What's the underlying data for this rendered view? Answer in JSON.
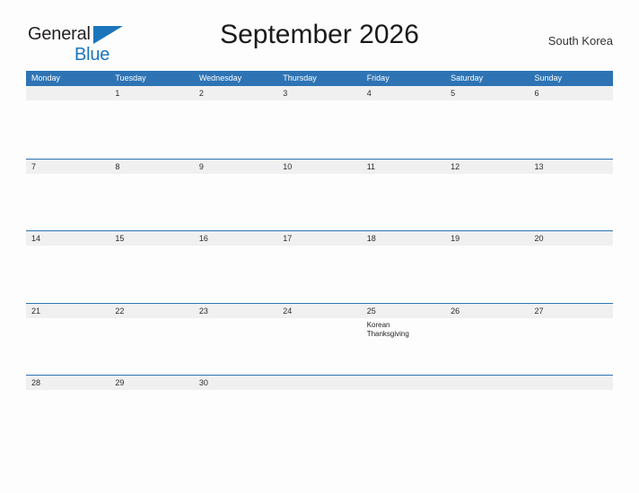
{
  "brand": {
    "name_part1": "General",
    "name_part2": "Blue",
    "flag_icon": "blue-triangle-flag",
    "color_dark": "#231f20",
    "color_blue": "#1b75bb"
  },
  "header": {
    "title": "September 2026",
    "region": "South Korea"
  },
  "theme": {
    "header_blue": "#2e74b5",
    "band_gray": "#f0f0f0",
    "page_background": "#fdfdfd",
    "text_color": "#222222"
  },
  "calendar": {
    "weekdays": [
      "Monday",
      "Tuesday",
      "Wednesday",
      "Thursday",
      "Friday",
      "Saturday",
      "Sunday"
    ],
    "weeks": [
      {
        "days": [
          {
            "number": "",
            "event": ""
          },
          {
            "number": "1",
            "event": ""
          },
          {
            "number": "2",
            "event": ""
          },
          {
            "number": "3",
            "event": ""
          },
          {
            "number": "4",
            "event": ""
          },
          {
            "number": "5",
            "event": ""
          },
          {
            "number": "6",
            "event": ""
          }
        ]
      },
      {
        "days": [
          {
            "number": "7",
            "event": ""
          },
          {
            "number": "8",
            "event": ""
          },
          {
            "number": "9",
            "event": ""
          },
          {
            "number": "10",
            "event": ""
          },
          {
            "number": "11",
            "event": ""
          },
          {
            "number": "12",
            "event": ""
          },
          {
            "number": "13",
            "event": ""
          }
        ]
      },
      {
        "days": [
          {
            "number": "14",
            "event": ""
          },
          {
            "number": "15",
            "event": ""
          },
          {
            "number": "16",
            "event": ""
          },
          {
            "number": "17",
            "event": ""
          },
          {
            "number": "18",
            "event": ""
          },
          {
            "number": "19",
            "event": ""
          },
          {
            "number": "20",
            "event": ""
          }
        ]
      },
      {
        "days": [
          {
            "number": "21",
            "event": ""
          },
          {
            "number": "22",
            "event": ""
          },
          {
            "number": "23",
            "event": ""
          },
          {
            "number": "24",
            "event": ""
          },
          {
            "number": "25",
            "event": "Korean Thanksgiving"
          },
          {
            "number": "26",
            "event": ""
          },
          {
            "number": "27",
            "event": ""
          }
        ]
      },
      {
        "days": [
          {
            "number": "28",
            "event": ""
          },
          {
            "number": "29",
            "event": ""
          },
          {
            "number": "30",
            "event": ""
          },
          {
            "number": "",
            "event": ""
          },
          {
            "number": "",
            "event": ""
          },
          {
            "number": "",
            "event": ""
          },
          {
            "number": "",
            "event": ""
          }
        ]
      }
    ]
  }
}
